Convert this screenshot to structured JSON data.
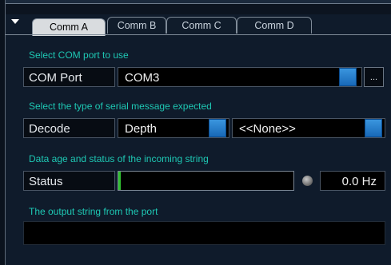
{
  "tabs": [
    "Comm A",
    "Comm B",
    "Comm C",
    "Comm D"
  ],
  "active_tab": "Comm A",
  "com_port": {
    "section_label": "Select COM port to use",
    "label": "COM Port",
    "value": "COM3",
    "browse_label": "..."
  },
  "decode": {
    "section_label": "Select the type of serial message expected",
    "label": "Decode",
    "value": "Depth",
    "secondary_value": "<<None>>"
  },
  "status": {
    "section_label": "Data age and status of the incoming string",
    "label": "Status",
    "rate": "0.0 Hz",
    "level": 0.01
  },
  "output": {
    "section_label": "The output string from the port",
    "value": ""
  },
  "colors": {
    "background": "#0f1b2b",
    "section_label": "#1ec8b4",
    "active_tab": "#d9dcdf",
    "button_blue": "#2a80cc",
    "status_fill": "#30c030"
  }
}
